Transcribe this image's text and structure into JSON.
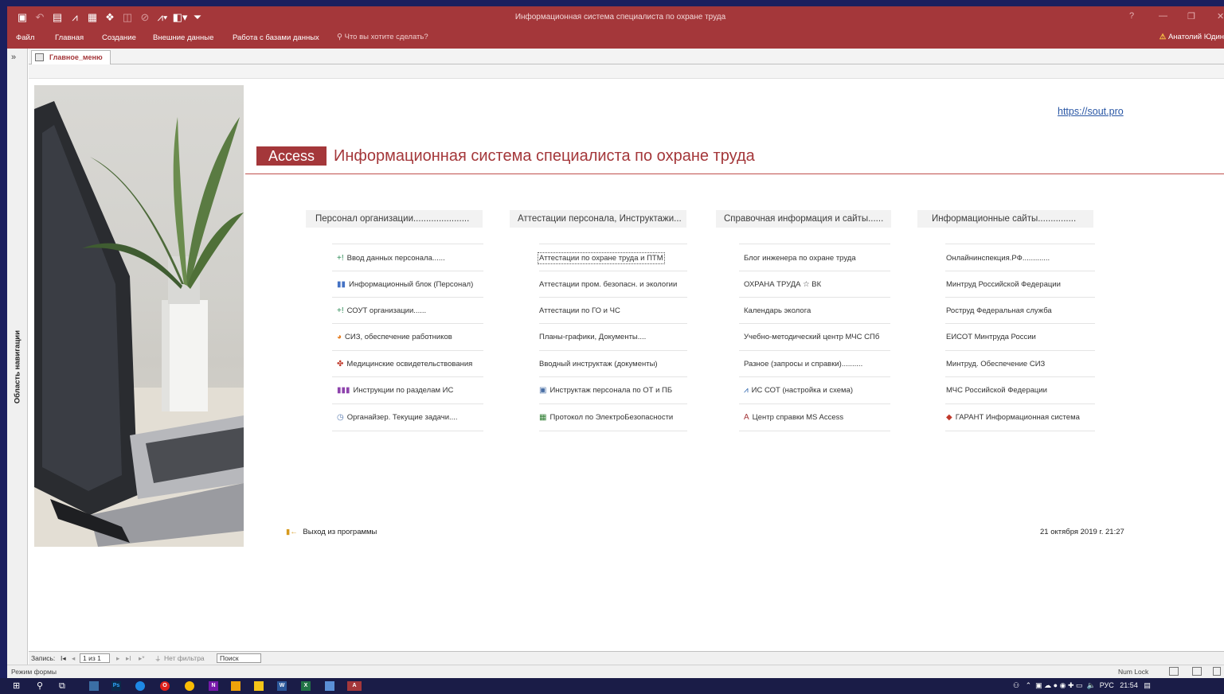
{
  "window": {
    "title": "Информационная система специалиста по охране труда",
    "help": "?",
    "minimize": "—",
    "maximize": "❐",
    "close": "✕"
  },
  "ribbon": {
    "tabs": [
      "Файл",
      "Главная",
      "Создание",
      "Внешние данные",
      "Работа с базами данных"
    ],
    "tell_me": "Что вы хотите сделать?",
    "user": "Анатолий Юдин"
  },
  "nav_pane": {
    "toggle": "»",
    "label": "Область навигации"
  },
  "doc_tab": {
    "label": "Главное_меню"
  },
  "header": {
    "site_link": "https://sout.pro",
    "badge": "Access",
    "title": "Информационная система специалиста по охране труда"
  },
  "columns": [
    {
      "heading": "Персонал организации......................",
      "items": [
        {
          "label": "Ввод данных персонала......",
          "icon": "+!",
          "icon_color": "#2e8b57"
        },
        {
          "label": "Информационный блок (Персонал)",
          "icon": "▮▮",
          "icon_color": "#4472c4"
        },
        {
          "label": "СОУТ организации......",
          "icon": "+!",
          "icon_color": "#2e8b57"
        },
        {
          "label": "СИЗ, обеспечение работников",
          "icon": "◕",
          "icon_color": "#e67e22"
        },
        {
          "label": "Медицинские освидетельствования",
          "icon": "✤",
          "icon_color": "#c0392b"
        },
        {
          "label": "Инструкции по разделам ИС",
          "icon": "▮▮▮",
          "icon_color": "#8e44ad"
        },
        {
          "label": "Органайзер. Текущие задачи....",
          "icon": "◷",
          "icon_color": "#5b7db1"
        }
      ]
    },
    {
      "heading": "Аттестации персонала, Инструктажи...",
      "items": [
        {
          "label": "Аттестации по охране труда и ПТМ",
          "icon": "",
          "icon_color": ""
        },
        {
          "label": "Аттестации пром. безопасн. и экологии",
          "icon": "",
          "icon_color": ""
        },
        {
          "label": "Аттестации по ГО и ЧС",
          "icon": "",
          "icon_color": ""
        },
        {
          "label": "Планы-графики, Документы....",
          "icon": "",
          "icon_color": ""
        },
        {
          "label": "Вводный инструктаж (документы)",
          "icon": "",
          "icon_color": ""
        },
        {
          "label": "Инструктаж персонала по ОТ и ПБ",
          "icon": "▣",
          "icon_color": "#4a6fa5"
        },
        {
          "label": "Протокол по ЭлектроБезопасности",
          "icon": "▦",
          "icon_color": "#2e7d32"
        }
      ]
    },
    {
      "heading": "Справочная информация и сайты......",
      "items": [
        {
          "label": "Блог инженера по охране труда",
          "icon": "",
          "icon_color": ""
        },
        {
          "label": "ОХРАНА ТРУДА ☆ ВК",
          "icon": "",
          "icon_color": ""
        },
        {
          "label": "Календарь эколога",
          "icon": "",
          "icon_color": ""
        },
        {
          "label": "Учебно-методический центр МЧС СПб",
          "icon": "",
          "icon_color": ""
        },
        {
          "label": "Разное (запросы и справки)..........",
          "icon": "",
          "icon_color": ""
        },
        {
          "label": "ИС СОТ (настройка и схема)",
          "icon": "⩘",
          "icon_color": "#1e5aa8"
        },
        {
          "label": "Центр справки MS Access",
          "icon": "A",
          "icon_color": "#a4373a"
        }
      ]
    },
    {
      "heading": "Информационные сайты...............",
      "items": [
        {
          "label": "Онлайнинспекция.РФ.............",
          "icon": "",
          "icon_color": ""
        },
        {
          "label": "Минтруд Российской Федерации",
          "icon": "",
          "icon_color": ""
        },
        {
          "label": "Роструд Федеральная служба",
          "icon": "",
          "icon_color": ""
        },
        {
          "label": "ЕИСОТ Минтруда России",
          "icon": "",
          "icon_color": ""
        },
        {
          "label": "Минтруд. Обеспечение СИЗ",
          "icon": "",
          "icon_color": ""
        },
        {
          "label": "МЧС Российской Федерации",
          "icon": "",
          "icon_color": ""
        },
        {
          "label": "ГАРАНТ Информационная система",
          "icon": "◆",
          "icon_color": "#c0392b"
        }
      ]
    }
  ],
  "footer": {
    "exit": "Выход из программы",
    "datetime": "21 октября 2019 г.   21:27"
  },
  "record_nav": {
    "label": "Запись:",
    "first": "I◂",
    "prev": "◂",
    "current": "1 из 1",
    "next": "▸",
    "last": "▸I",
    "new": "▸*",
    "filter": "Нет фильтра",
    "search": "Поиск"
  },
  "status_bar": {
    "mode": "Режим формы",
    "num_lock": "Num Lock"
  },
  "taskbar": {
    "lang": "РУС",
    "time": "21:54"
  },
  "colors": {
    "accent": "#a4373a",
    "link": "#2a57a5",
    "taskbar": "#1a1c47"
  }
}
